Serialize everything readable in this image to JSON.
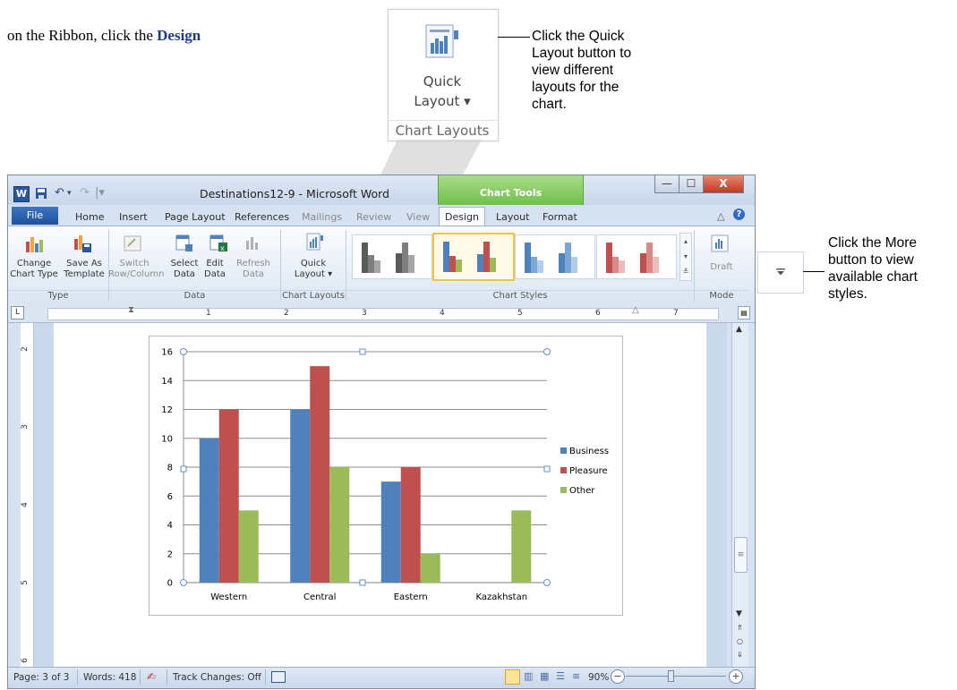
{
  "intro": {
    "prefix": "on the Ribbon, click the ",
    "bold": "Design"
  },
  "callouts": {
    "quick_layout_big": {
      "line1": "Quick",
      "line2": "Layout ▾",
      "group": "Chart Layouts"
    },
    "quick_layout_desc": "Click the Quick\nLayout button to\nview different\nlayouts for the\nchart.",
    "more_desc": "Click the More\nbutton to view\navailable chart\nstyles.",
    "more_icon": "more-arrow-icon"
  },
  "window": {
    "title": "Destinations12-9  -  Microsoft Word",
    "app_icon": "W",
    "contextual_tab": "Chart Tools",
    "controls": {
      "minimize": "—",
      "maximize": "☐",
      "close": "X"
    }
  },
  "tabs": [
    "Home",
    "Insert",
    "Page Layout",
    "References",
    "Mailings",
    "Review",
    "View",
    "Design",
    "Layout",
    "Format"
  ],
  "file_tab": "File",
  "ribbon": {
    "change_chart_type": [
      "Change",
      "Chart Type"
    ],
    "save_as_template": [
      "Save As",
      "Template"
    ],
    "switch_row_column": [
      "Switch",
      "Row/Column"
    ],
    "select_data": [
      "Select",
      "Data"
    ],
    "edit_data": [
      "Edit",
      "Data"
    ],
    "refresh_data": [
      "Refresh",
      "Data"
    ],
    "quick_layout": [
      "Quick",
      "Layout ▾"
    ],
    "draft": "Draft",
    "groups": {
      "type": "Type",
      "data": "Data",
      "chart_layouts": "Chart Layouts",
      "chart_styles": "Chart Styles",
      "mode": "Mode"
    },
    "style_colors": [
      [
        "#5a5a5a",
        "#7f7f7f",
        "#a6a6a6"
      ],
      [
        "#4f81bd",
        "#c0504d",
        "#9bbb59"
      ],
      [
        "#4f81bd",
        "#7da6d8",
        "#b3cde8"
      ],
      [
        "#c0504d",
        "#d98a88",
        "#ecbcbb"
      ]
    ]
  },
  "ruler": {
    "numbers": [
      "1",
      "2",
      "3",
      "4",
      "5",
      "6",
      "7"
    ],
    "vnumbers": [
      "2",
      "3",
      "4",
      "5",
      "6"
    ]
  },
  "status": {
    "page": "Page: 3 of 3",
    "words": "Words: 418",
    "track_changes": "Track Changes: Off",
    "zoom": "90%"
  },
  "chart_data": {
    "type": "bar",
    "categories": [
      "Western",
      "Central",
      "Eastern",
      "Kazakhstan"
    ],
    "series": [
      {
        "name": "Business",
        "values": [
          10,
          12,
          7,
          0
        ],
        "color": "#4f81bd"
      },
      {
        "name": "Pleasure",
        "values": [
          12,
          15,
          8,
          0
        ],
        "color": "#c0504d"
      },
      {
        "name": "Other",
        "values": [
          5,
          8,
          2,
          5
        ],
        "color": "#9bbb59"
      }
    ],
    "ylim": [
      0,
      16
    ],
    "yticks": [
      "0",
      "2",
      "4",
      "6",
      "8",
      "10",
      "12",
      "14",
      "16"
    ],
    "grid": true,
    "legend": "right"
  }
}
